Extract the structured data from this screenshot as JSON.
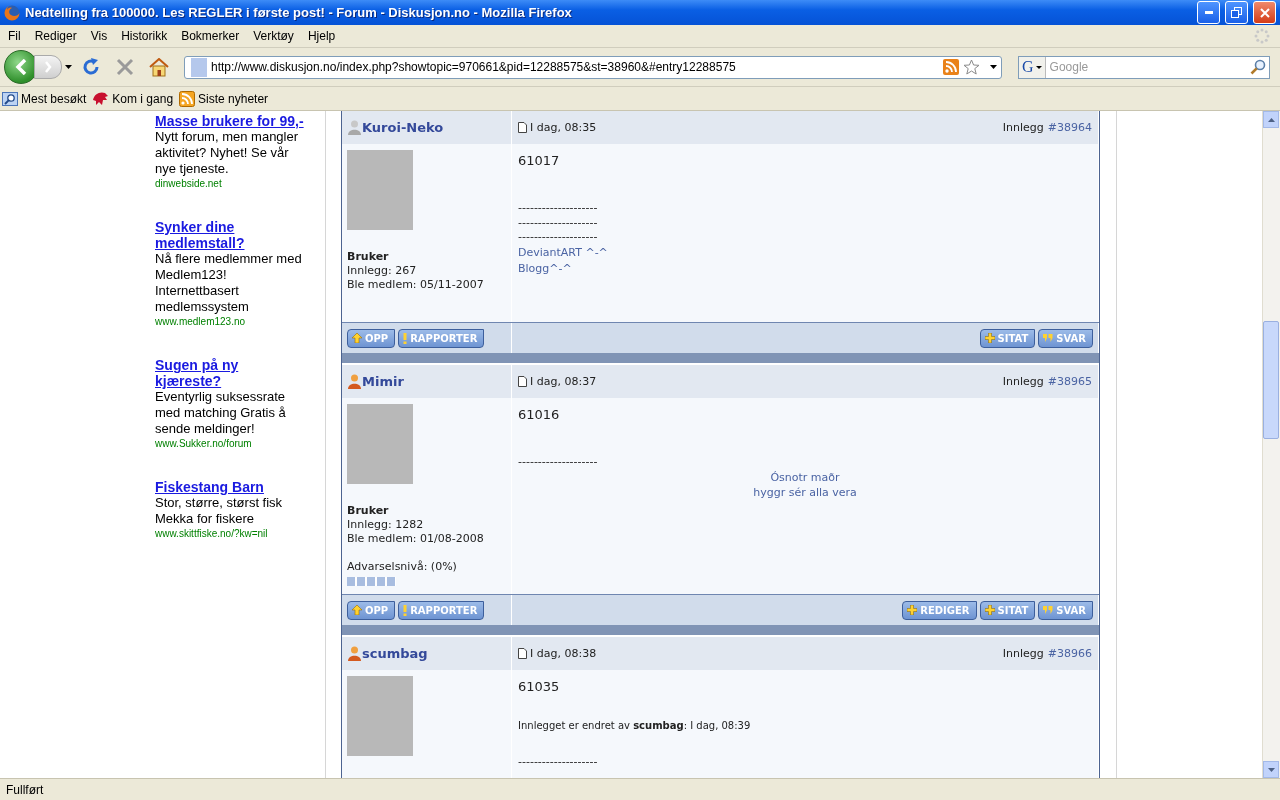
{
  "window": {
    "title": "Nedtelling fra 100000. Les REGLER i første post! - Forum - Diskusjon.no - Mozilla Firefox"
  },
  "menu": [
    "Fil",
    "Rediger",
    "Vis",
    "Historikk",
    "Bokmerker",
    "Verktøy",
    "Hjelp"
  ],
  "address": {
    "value": "http://www.diskusjon.no/index.php?showtopic=970661&pid=12288575&st=38960&#entry12288575"
  },
  "search": {
    "placeholder": "Google",
    "engine": "G"
  },
  "bookmarks": [
    {
      "label": "Mest besøkt",
      "kind": "smart"
    },
    {
      "label": "Kom i gang",
      "kind": "start"
    },
    {
      "label": "Siste nyheter",
      "kind": "feed"
    }
  ],
  "ads": [
    {
      "title": "Masse brukere for 99,-",
      "text": "Nytt forum, men mangler aktivitet? Nyhet! Se vår nye tjeneste.",
      "url": "dinwebside.net"
    },
    {
      "title": "Synker dine medlemstall?",
      "text": "Nå flere medlemmer med Medlem123! Internettbasert medlemssystem",
      "url": "www.medlem123.no"
    },
    {
      "title": "Sugen på ny kjæreste?",
      "text": "Eventyrlig suksessrate med matching Gratis å sende meldinger!",
      "url": "www.Sukker.no/forum"
    },
    {
      "title": "Fiskestang Barn",
      "text": "Stor, større, størst fisk Mekka for fiskere",
      "url": "www.skittfiske.no/?kw=nil"
    }
  ],
  "posts": [
    {
      "author": "Kuroi-Neko",
      "online": false,
      "date": "I dag, 08:35",
      "entry_label": "Innlegg",
      "entry_number": "#38964",
      "group": "Bruker",
      "post_count": "Innlegg: 267",
      "joined": "Ble medlem: 05/11-2007",
      "body": [
        {
          "kind": "number",
          "text": "61017"
        },
        {
          "kind": "dashes",
          "text": "--------------------"
        },
        {
          "kind": "dashes",
          "text": "--------------------"
        },
        {
          "kind": "dashes",
          "text": "--------------------"
        },
        {
          "kind": "link",
          "text": "DeviantART ^-^"
        },
        {
          "kind": "link",
          "text": "Blogg^-^"
        }
      ],
      "left_buttons": [
        {
          "label": "OPP",
          "kind": "up"
        },
        {
          "label": "RAPPORTER",
          "kind": "report"
        }
      ],
      "right_buttons": [
        {
          "label": "SITAT",
          "kind": "quote"
        },
        {
          "label": "SVAR",
          "kind": "reply"
        }
      ]
    },
    {
      "author": "Mimir",
      "online": true,
      "date": "I dag, 08:37",
      "entry_label": "Innlegg",
      "entry_number": "#38965",
      "group": "Bruker",
      "post_count": "Innlegg: 1282",
      "joined": "Ble medlem: 01/08-2008",
      "warning": {
        "label": "Advarselsnivå: (0%)",
        "level": 0
      },
      "body": [
        {
          "kind": "number",
          "text": "61016"
        },
        {
          "kind": "dashes",
          "text": "--------------------"
        },
        {
          "kind": "centered",
          "text": "Ósnotr maðr"
        },
        {
          "kind": "centered",
          "text": "hyggr sér alla vera"
        }
      ],
      "left_buttons": [
        {
          "label": "OPP",
          "kind": "up"
        },
        {
          "label": "RAPPORTER",
          "kind": "report"
        }
      ],
      "right_buttons": [
        {
          "label": "REDIGER",
          "kind": "edit"
        },
        {
          "label": "SITAT",
          "kind": "quote"
        },
        {
          "label": "SVAR",
          "kind": "reply"
        }
      ]
    },
    {
      "author": "scumbag",
      "online": true,
      "date": "I dag, 08:38",
      "entry_label": "Innlegg",
      "entry_number": "#38966",
      "body": [
        {
          "kind": "number",
          "text": "61035"
        },
        {
          "kind": "note",
          "text": "Innlegget er endret av **scumbag**: I dag, 08:39"
        },
        {
          "kind": "dashes",
          "text": "--------------------"
        }
      ]
    }
  ],
  "status_bar": "Fullført"
}
